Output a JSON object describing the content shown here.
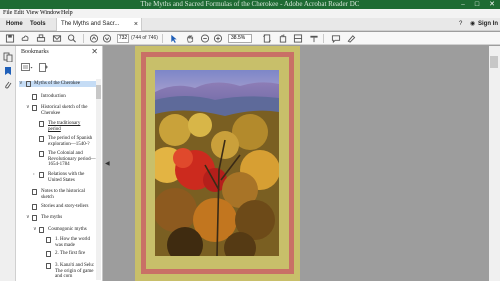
{
  "window": {
    "title": "The Myths and Sacred Formulas of the Cherokee - Adobe Acrobat Reader DC"
  },
  "menu": {
    "items": [
      "File",
      "Edit",
      "View",
      "Window",
      "Help"
    ]
  },
  "tabs": {
    "home": "Home",
    "tools": "Tools",
    "document": "The Myths and Sacr...",
    "sign": "Sign In"
  },
  "toolbar": {
    "page_value": "732",
    "page_count": "(744 of 746)",
    "zoom": "38.5%"
  },
  "bookmarks": {
    "title": "Bookmarks",
    "items": [
      {
        "label": "Myths of the Cherokee",
        "level": 0,
        "twisty": "v",
        "selected": true
      },
      {
        "label": "Introduction",
        "level": 1,
        "twisty": ""
      },
      {
        "label": "Historical sketch of the Cherokee",
        "level": 1,
        "twisty": "v"
      },
      {
        "label": "The traditionary period",
        "level": 2,
        "twisty": ""
      },
      {
        "label": "The period of Spanish exploration—1540-?",
        "level": 2,
        "twisty": ""
      },
      {
        "label": "The Colonial and Revolutionary period—1654-1784",
        "level": 2,
        "twisty": ""
      },
      {
        "label": "Relations with the United States",
        "level": 2,
        "twisty": ">"
      },
      {
        "label": "Notes to the historical sketch",
        "level": 1,
        "twisty": ""
      },
      {
        "label": "Stories and story-tellers",
        "level": 1,
        "twisty": ""
      },
      {
        "label": "The myths",
        "level": 1,
        "twisty": "v"
      },
      {
        "label": "Cosmogonic myths",
        "level": 2,
        "twisty": "v"
      },
      {
        "label": "1. How the world was made",
        "level": 3,
        "twisty": ""
      },
      {
        "label": "2. The first fire",
        "level": 3,
        "twisty": ""
      },
      {
        "label": "3. Kana'ti and Selu: The origin of game and corn",
        "level": 3,
        "twisty": ""
      }
    ]
  },
  "colors": {
    "titlebar": "#1e6b33",
    "page_background": "#c8bf6a",
    "frame": "#c97066"
  }
}
